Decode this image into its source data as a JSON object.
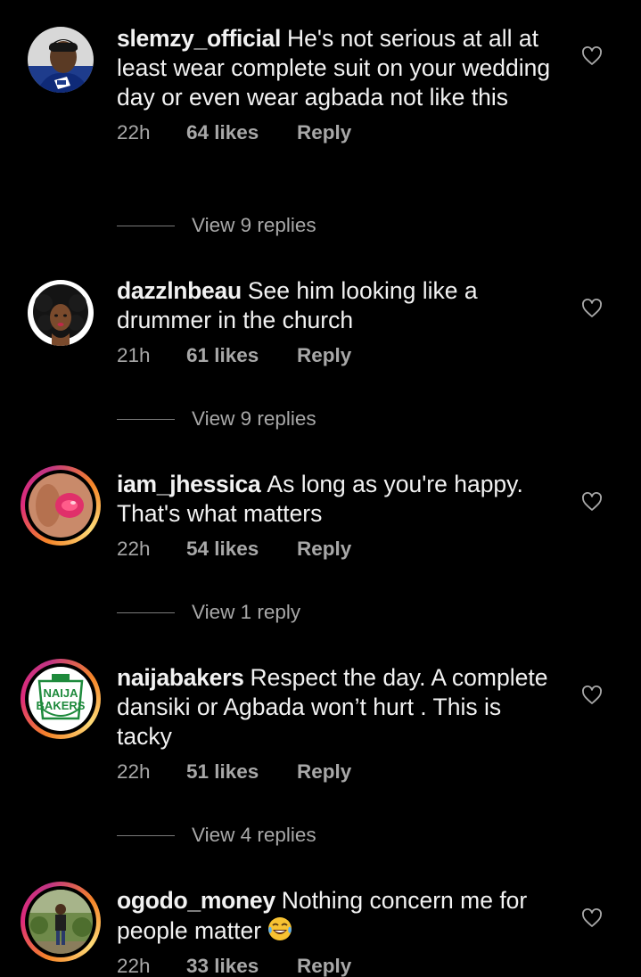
{
  "comments": [
    {
      "username": "slemzy_official",
      "text": "He's not serious at all at least wear complete suit on your wedding day or even wear agbada not like this",
      "time": "22h",
      "likes": "64 likes",
      "reply_label": "Reply",
      "view_replies": "View 9 replies",
      "story_ring": false,
      "avatar": "man-with-cap-avatar"
    },
    {
      "username": "dazzlnbeau",
      "text": "See him looking like a drummer in the church",
      "time": "21h",
      "likes": "61 likes",
      "reply_label": "Reply",
      "view_replies": "View 9 replies",
      "story_ring": false,
      "avatar": "curly-hair-woman-illustration-avatar"
    },
    {
      "username": "iam_jhessica",
      "text": "As long as you're happy. That's what matters",
      "time": "22h",
      "likes": "54 likes",
      "reply_label": "Reply",
      "view_replies": "View 1 reply",
      "story_ring": true,
      "avatar": "close-up-lips-avatar"
    },
    {
      "username": "naijabakers",
      "text": "Respect the day. A complete dansiki or Agbada won’t hurt . This is tacky",
      "time": "22h",
      "likes": "51 likes",
      "reply_label": "Reply",
      "view_replies": "View 4 replies",
      "story_ring": true,
      "avatar": "naija-bakers-logo-avatar",
      "logo_text": [
        "NAIJA",
        "BAKERS"
      ]
    },
    {
      "username": "ogodo_money",
      "text": "Nothing concern me for people matter",
      "emoji": "laughing-tears-emoji",
      "time": "22h",
      "likes": "33 likes",
      "reply_label": "Reply",
      "story_ring": true,
      "avatar": "man-in-garden-avatar"
    }
  ],
  "colors": {
    "background": "#000000",
    "primary_text": "#f2f2f2",
    "secondary_text": "#a8a8a8",
    "divider": "#7a7a7a"
  }
}
